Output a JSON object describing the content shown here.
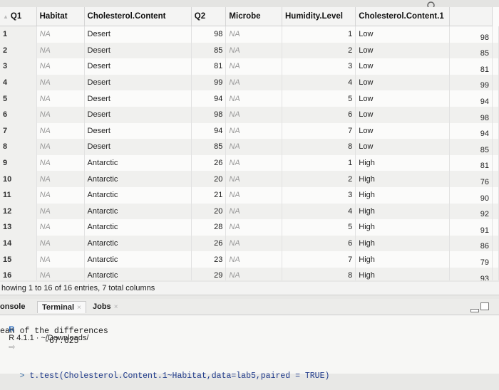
{
  "columns": [
    "Q1",
    "Habitat",
    "Cholesterol.Content",
    "Q2",
    "Microbe",
    "Humidity.Level",
    "Cholesterol.Content.1"
  ],
  "rows": [
    [
      "1",
      "NA",
      "Desert",
      "98",
      "NA",
      "1",
      "Low",
      "98"
    ],
    [
      "2",
      "NA",
      "Desert",
      "85",
      "NA",
      "2",
      "Low",
      "85"
    ],
    [
      "3",
      "NA",
      "Desert",
      "81",
      "NA",
      "3",
      "Low",
      "81"
    ],
    [
      "4",
      "NA",
      "Desert",
      "99",
      "NA",
      "4",
      "Low",
      "99"
    ],
    [
      "5",
      "NA",
      "Desert",
      "94",
      "NA",
      "5",
      "Low",
      "94"
    ],
    [
      "6",
      "NA",
      "Desert",
      "98",
      "NA",
      "6",
      "Low",
      "98"
    ],
    [
      "7",
      "NA",
      "Desert",
      "94",
      "NA",
      "7",
      "Low",
      "94"
    ],
    [
      "8",
      "NA",
      "Desert",
      "85",
      "NA",
      "8",
      "Low",
      "85"
    ],
    [
      "9",
      "NA",
      "Antarctic",
      "26",
      "NA",
      "1",
      "High",
      "81"
    ],
    [
      "10",
      "NA",
      "Antarctic",
      "20",
      "NA",
      "2",
      "High",
      "76"
    ],
    [
      "11",
      "NA",
      "Antarctic",
      "21",
      "NA",
      "3",
      "High",
      "90"
    ],
    [
      "12",
      "NA",
      "Antarctic",
      "20",
      "NA",
      "4",
      "High",
      "92"
    ],
    [
      "13",
      "NA",
      "Antarctic",
      "28",
      "NA",
      "5",
      "High",
      "91"
    ],
    [
      "14",
      "NA",
      "Antarctic",
      "26",
      "NA",
      "6",
      "High",
      "86"
    ],
    [
      "15",
      "NA",
      "Antarctic",
      "23",
      "NA",
      "7",
      "High",
      "79"
    ],
    [
      "16",
      "NA",
      "Antarctic",
      "29",
      "NA",
      "8",
      "High",
      "93"
    ]
  ],
  "footer": "howing 1 to 16 of 16 entries, 7 total columns",
  "tabs": {
    "console": "onsole",
    "terminal": "Terminal",
    "jobs": "Jobs"
  },
  "console": {
    "r_version": "R 4.1.1 · ~/Downloads/",
    "line1": "ean of the differences",
    "line2": "         -67.625",
    "command": "t.test(Cholesterol.Content.1~Habitat,data=lab5,paired = TRUE)"
  }
}
